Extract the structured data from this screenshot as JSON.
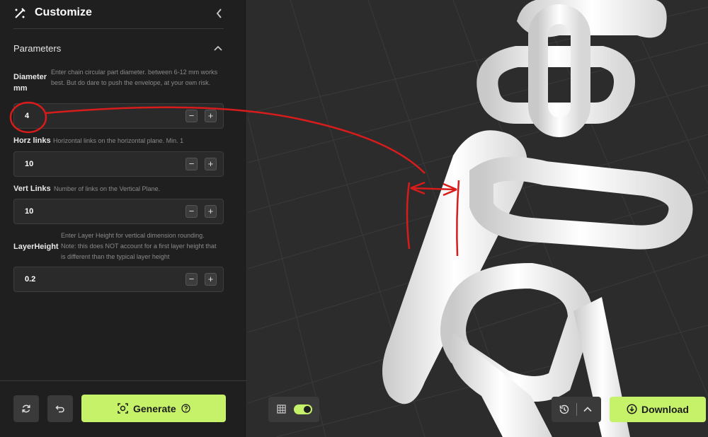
{
  "header": {
    "title": "Customize"
  },
  "section": {
    "title": "Parameters"
  },
  "params": [
    {
      "label": "Diameter mm",
      "description": "Enter chain circular part diameter. between 6-12 mm works best. But do dare to push the envelope, at your own risk.",
      "value": "4"
    },
    {
      "label": "Horz links",
      "description": "Horizontal links on the horizontal plane. Min. 1",
      "value": "10"
    },
    {
      "label": "Vert Links",
      "description": "Number of links on the Vertical Plane.",
      "value": "10"
    },
    {
      "label": "LayerHeight",
      "description": "Enter Layer Height for vertical dimension rounding. Note: this does NOT account for a first layer height that is different than the typical layer height",
      "value": "0.2"
    }
  ],
  "stepper": {
    "minus": "−",
    "plus": "+"
  },
  "actions": {
    "generate_label": "Generate",
    "download_label": "Download"
  },
  "colors": {
    "accent": "#c6f26a",
    "sidebar": "#1f1f1f",
    "viewport": "#2c2c2c",
    "annotation": "#d81b1b"
  },
  "icons": [
    "customize-icon",
    "chevron-left-icon",
    "chevron-up-icon",
    "refresh-icon",
    "undo-icon",
    "generate-icon",
    "help-icon",
    "grid-icon",
    "history-icon",
    "download-icon"
  ]
}
